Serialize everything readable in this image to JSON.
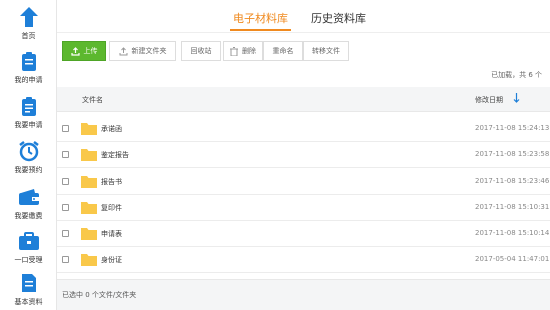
{
  "sidebar": {
    "items": [
      {
        "label": "首页",
        "icon": "home-icon"
      },
      {
        "label": "我的申请",
        "icon": "clipboard-icon"
      },
      {
        "label": "我要申请",
        "icon": "clipboard-edit-icon"
      },
      {
        "label": "我要预约",
        "icon": "alarm-clock-icon"
      },
      {
        "label": "我要缴费",
        "icon": "wallet-icon"
      },
      {
        "label": "一口受理",
        "icon": "briefcase-icon"
      },
      {
        "label": "基本资料",
        "icon": "document-icon"
      }
    ]
  },
  "tabs": [
    {
      "label": "电子材料库",
      "active": true
    },
    {
      "label": "历史资料库",
      "active": false
    }
  ],
  "toolbar": {
    "upload": "上传",
    "new_folder": "新建文件夹",
    "recycle": "回收站",
    "delete": "删除",
    "rename": "重命名",
    "move": "转移文件"
  },
  "status": {
    "loaded": "已加载，共 6 个"
  },
  "table": {
    "col_name": "文件名",
    "col_date": "修改日期",
    "rows": [
      {
        "name": "承诺函",
        "date": "2017-11-08 15:24:13"
      },
      {
        "name": "鉴定报告",
        "date": "2017-11-08 15:23:58"
      },
      {
        "name": "报告书",
        "date": "2017-11-08 15:23:46"
      },
      {
        "name": "复印件",
        "date": "2017-11-08 15:10:31"
      },
      {
        "name": "申请表",
        "date": "2017-11-08 15:10:14"
      },
      {
        "name": "身份证",
        "date": "2017-05-04 11:47:01"
      }
    ]
  },
  "footer": {
    "selected": "已选中 0 个文件/文件夹"
  },
  "colors": {
    "accent": "#f08a1f",
    "upload_green": "#5cb82e",
    "sidebar_icon": "#1e7fd8",
    "folder": "#f9c84a"
  }
}
